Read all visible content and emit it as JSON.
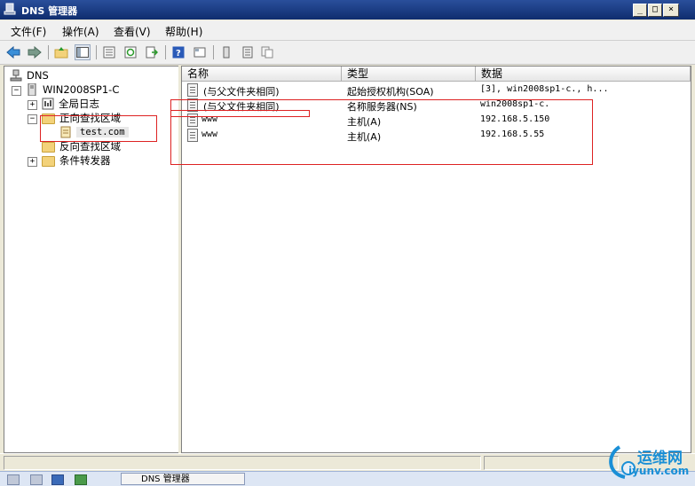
{
  "window": {
    "title": "DNS 管理器",
    "min_label": "_",
    "max_label": "□",
    "close_label": "×"
  },
  "menu": [
    "文件(F)",
    "操作(A)",
    "查看(V)",
    "帮助(H)"
  ],
  "tree": {
    "root": "DNS",
    "server": "WIN2008SP1-C",
    "global_logs": "全局日志",
    "forward_zones": "正向查找区域",
    "zone_test": "test.com",
    "reverse_zones": "反向查找区域",
    "conditional_forwarders": "条件转发器"
  },
  "columns": {
    "name": "名称",
    "type": "类型",
    "data": "数据"
  },
  "records": [
    {
      "name": "(与父文件夹相同)",
      "type": "起始授权机构(SOA)",
      "data": "[3], win2008sp1-c., h..."
    },
    {
      "name": "(与父文件夹相同)",
      "type": "名称服务器(NS)",
      "data": "win2008sp1-c."
    },
    {
      "name": "www",
      "type": "主机(A)",
      "data": "192.168.5.150"
    },
    {
      "name": "www",
      "type": "主机(A)",
      "data": "192.168.5.55"
    }
  ],
  "taskbar": {
    "task_label": "DNS 管理器"
  },
  "watermark": {
    "text": "运维网",
    "sub": "iyunv.com"
  },
  "colors": {
    "title_bar": "#0f2d6e",
    "highlight_box": "#d22222",
    "watermark": "#1a8fd6"
  }
}
